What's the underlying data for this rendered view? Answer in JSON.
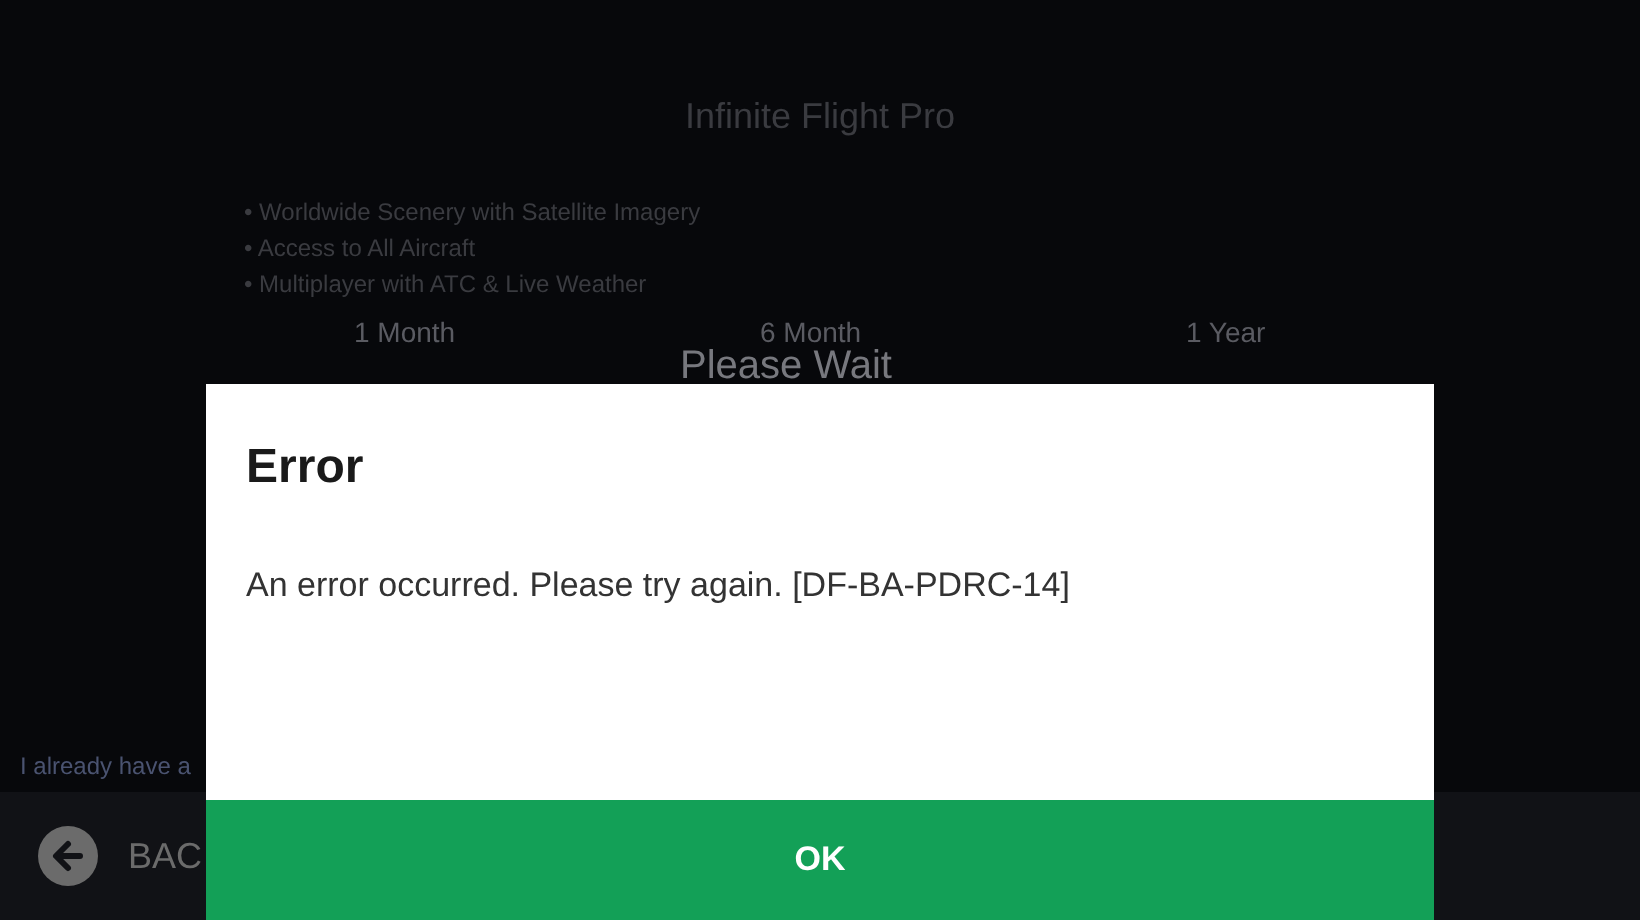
{
  "screen": {
    "title": "Infinite Flight Pro",
    "features": [
      "• Worldwide Scenery with Satellite Imagery",
      "• Access to All Aircraft",
      "• Multiplayer with ATC & Live Weather"
    ],
    "plans": [
      "1 Month",
      "6 Month",
      "1 Year"
    ],
    "loading_text": "Please Wait",
    "restore_link": "I already have a",
    "back_button": "BAC"
  },
  "dialog": {
    "title": "Error",
    "message": "An error occurred. Please try again. [DF-BA-PDRC-14]",
    "button": "OK"
  }
}
